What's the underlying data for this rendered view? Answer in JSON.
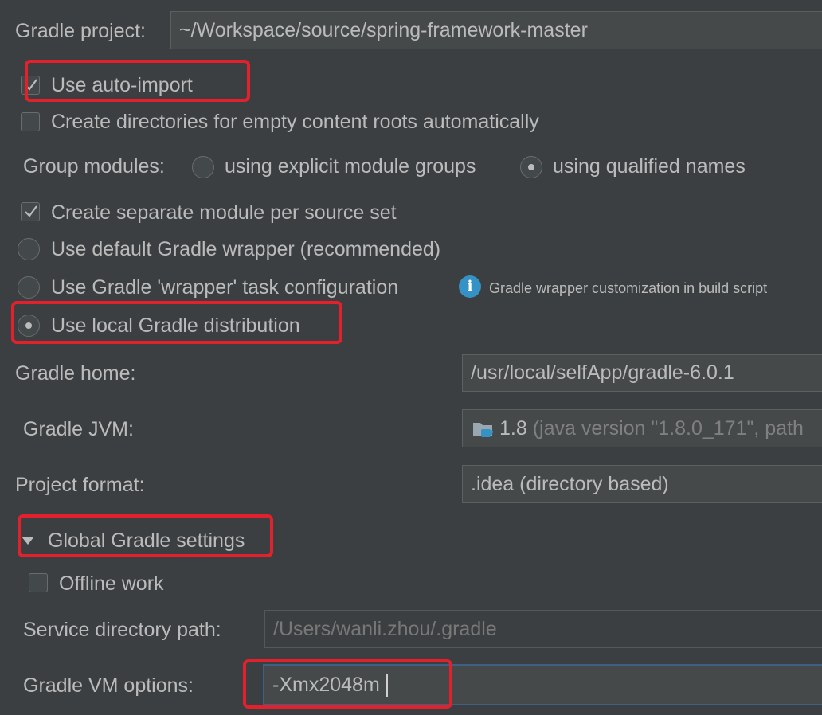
{
  "gradle_project": {
    "label": "Gradle project:",
    "value": "~/Workspace/source/spring-framework-master"
  },
  "options": {
    "use_auto_import": {
      "label": "Use auto-import",
      "checked": true
    },
    "create_directories": {
      "label": "Create directories for empty content roots automatically",
      "checked": false
    },
    "group_modules": {
      "label": "Group modules:",
      "explicit_groups": "using explicit module groups",
      "qualified_names": "using qualified names",
      "selected": "qualified_names"
    },
    "separate_module": {
      "label": "Create separate module per source set",
      "checked": true
    }
  },
  "distribution": {
    "default_wrapper": "Use default Gradle wrapper (recommended)",
    "wrapper_task": "Use Gradle 'wrapper' task configuration",
    "wrapper_note": "Gradle wrapper customization in build script",
    "local_distribution": "Use local Gradle distribution",
    "selected": "local_distribution"
  },
  "gradle_home": {
    "label": "Gradle home:",
    "value": "/usr/local/selfApp/gradle-6.0.1"
  },
  "gradle_jvm": {
    "label": "Gradle JVM:",
    "version": "1.8",
    "detail": "(java version \"1.8.0_171\", path"
  },
  "project_format": {
    "label": "Project format:",
    "value": ".idea (directory based)"
  },
  "global_settings": {
    "title": "Global Gradle settings",
    "offline_work": {
      "label": "Offline work",
      "checked": false
    },
    "service_directory": {
      "label": "Service directory path:",
      "value": "/Users/wanli.zhou/.gradle"
    },
    "vm_options": {
      "label": "Gradle VM options:",
      "value": "-Xmx2048m"
    }
  },
  "colors": {
    "background": "#3c3f41",
    "text": "#bbbbbb",
    "highlight": "#e3212c",
    "info_icon": "#3592c4",
    "focus_border": "#3d6185"
  },
  "icons": {
    "checkbox_check": "check-icon",
    "info": "info-icon",
    "expand": "triangle-down-icon",
    "jdk": "folder-coffee-icon"
  }
}
